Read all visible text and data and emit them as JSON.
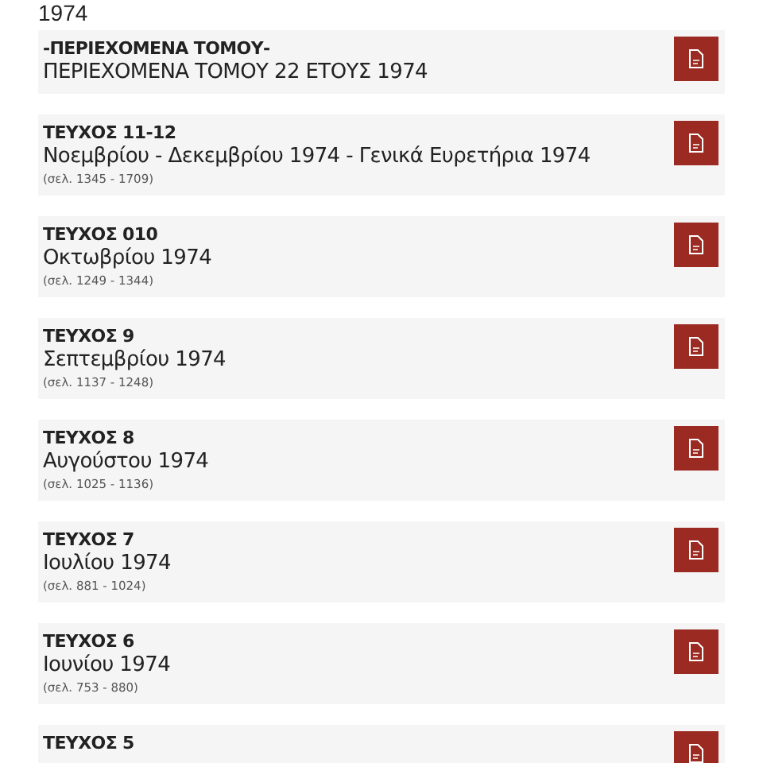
{
  "heading": "1974",
  "issues": [
    {
      "title": "-ΠΕΡΙΕΧΟΜΕΝΑ ΤΟΜΟΥ-",
      "subtitle": "ΠΕΡΙΕΧΟΜΕΝΑ ΤΟΜΟΥ 22 ΕΤΟΥΣ 1974"
    },
    {
      "title": "ΤΕΥΧΟΣ 11-12",
      "subtitle": "Νοεμβρίου - Δεκεμβρίου 1974 - Γενικά Ευρετήρια 1974",
      "pages": "(σελ. 1345 - 1709)"
    },
    {
      "title": "ΤΕΥΧΟΣ 010",
      "subtitle": "Οκτωβρίου 1974",
      "pages": "(σελ. 1249 - 1344)"
    },
    {
      "title": "ΤΕΥΧΟΣ 9",
      "subtitle": "Σεπτεμβρίου 1974",
      "pages": "(σελ. 1137 - 1248)"
    },
    {
      "title": "ΤΕΥΧΟΣ 8",
      "subtitle": "Αυγούστου 1974",
      "pages": "(σελ. 1025 - 1136)"
    },
    {
      "title": "ΤΕΥΧΟΣ 7",
      "subtitle": "Ιουλίου 1974",
      "pages": "(σελ. 881 - 1024)"
    },
    {
      "title": "ΤΕΥΧΟΣ 6",
      "subtitle": "Ιουνίου 1974",
      "pages": "(σελ. 753 - 880)"
    },
    {
      "title": "ΤΕΥΧΟΣ 5"
    }
  ]
}
